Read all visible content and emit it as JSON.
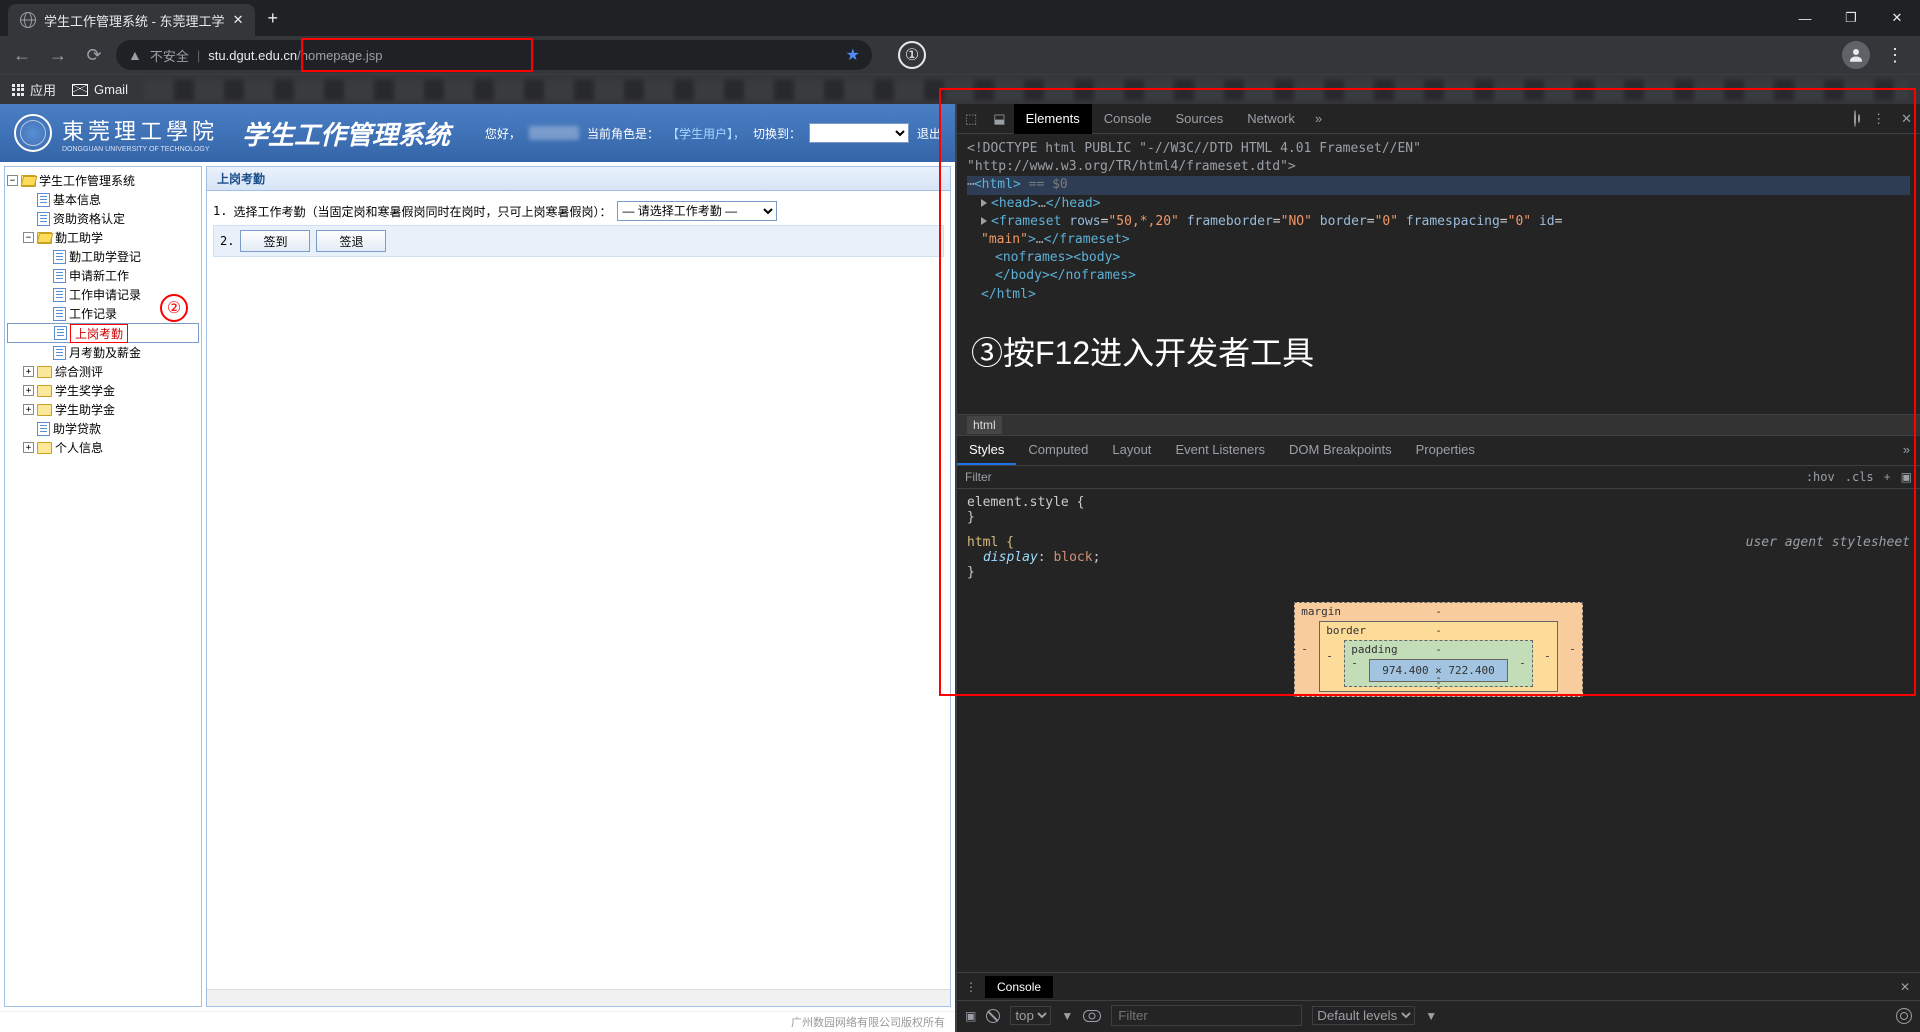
{
  "browser": {
    "tab_title": "学生工作管理系统 - 东莞理工学",
    "url_insecure": "不安全",
    "url_domain": "stu.dgut.edu.cn",
    "url_path": "/homepage.jsp",
    "bookmarks": {
      "apps": "应用",
      "gmail": "Gmail"
    }
  },
  "annotations": {
    "circ1": "①",
    "circ2": "②",
    "text3": "③按F12进入开发者工具"
  },
  "app": {
    "uni_name": "東莞理工學院",
    "uni_sub": "DONGGUAN UNIVERSITY OF TECHNOLOGY",
    "title": "学生工作管理系统",
    "greeting": "您好，",
    "role_label": "当前角色是：",
    "role_value": "【学生用户】，",
    "switch_label": "切换到：",
    "logout": "退出",
    "tree": {
      "root": "学生工作管理系统",
      "basic": "基本信息",
      "qualify": "资助资格认定",
      "workstudy": "勤工助学",
      "ws_children": [
        "勤工助学登记",
        "申请新工作",
        "工作申请记录",
        "工作记录",
        "上岗考勤",
        "月考勤及薪金"
      ],
      "eval": "综合测评",
      "scholarship": "学生奖学金",
      "stipend": "学生助学金",
      "loan": "助学贷款",
      "personal": "个人信息"
    },
    "main": {
      "tab": "上岗考勤",
      "step1": "选择工作考勤（当固定岗和寒暑假岗同时在岗时，只可上岗寒暑假岗）：",
      "select_placeholder": "— 请选择工作考勤 —",
      "num1": "1.",
      "num2": "2.",
      "signin": "签到",
      "signout": "签退"
    },
    "footer": "广州数园网络有限公司版权所有"
  },
  "devtools": {
    "tabs": [
      "Elements",
      "Console",
      "Sources",
      "Network"
    ],
    "doctype1": "<!DOCTYPE html PUBLIC \"-//W3C//DTD HTML 4.01 Frameset//EN\"",
    "doctype2": "\"http://www.w3.org/TR/html4/frameset.dtd\">",
    "html_line": "<html> == $0",
    "head_line": "<head>…</head>",
    "frameset_line": "<frameset rows=\"50,*,20\" frameborder=\"NO\" border=\"0\" framespacing=\"0\" id=\"main\">…</frameset>",
    "noframes_open": "<noframes><body>",
    "body_noframes_close": "</body></noframes>",
    "html_close": "</html>",
    "crumb": "html",
    "styles_tabs": [
      "Styles",
      "Computed",
      "Layout",
      "Event Listeners",
      "DOM Breakpoints",
      "Properties"
    ],
    "filter": "Filter",
    "hov": ":hov",
    "cls": ".cls",
    "element_style": "element.style {",
    "html_rule": "html {",
    "display_prop": "display",
    "display_val": "block",
    "uas": "user agent stylesheet",
    "box": {
      "margin": "margin",
      "border": "border",
      "padding": "padding",
      "content": "974.400 × 722.400",
      "dash": "-"
    },
    "console": {
      "label": "Console",
      "top": "top",
      "filter": "Filter",
      "levels": "Default levels"
    }
  }
}
